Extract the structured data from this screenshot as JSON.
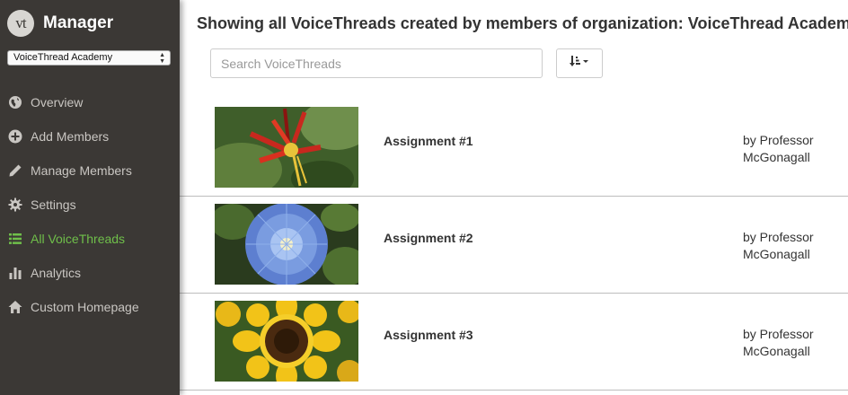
{
  "sidebar": {
    "logo_text": "vt",
    "title": "Manager",
    "org_select": "VoiceThread Academy",
    "items": [
      {
        "label": "Overview",
        "icon": "globe-icon",
        "active": false
      },
      {
        "label": "Add Members",
        "icon": "plus-circle-icon",
        "active": false
      },
      {
        "label": "Manage Members",
        "icon": "pencil-icon",
        "active": false
      },
      {
        "label": "Settings",
        "icon": "gear-icon",
        "active": false
      },
      {
        "label": "All VoiceThreads",
        "icon": "list-icon",
        "active": true
      },
      {
        "label": "Analytics",
        "icon": "bar-chart-icon",
        "active": false
      },
      {
        "label": "Custom Homepage",
        "icon": "home-icon",
        "active": false
      }
    ]
  },
  "main": {
    "heading": "Showing all VoiceThreads created by members of organization: VoiceThread Academy",
    "search_placeholder": "Search VoiceThreads",
    "sort_icon": "sort-icon",
    "threads": [
      {
        "title": "Assignment #1",
        "author_line1": "by Professor",
        "author_line2": "McGonagall",
        "thumbnail": "red-columbine-flower"
      },
      {
        "title": "Assignment #2",
        "author_line1": "by Professor",
        "author_line2": "McGonagall",
        "thumbnail": "blue-morning-glory-flower"
      },
      {
        "title": "Assignment #3",
        "author_line1": "by Professor",
        "author_line2": "McGonagall",
        "thumbnail": "sunflower"
      }
    ]
  },
  "colors": {
    "sidebar_bg": "#3b3835",
    "sidebar_text": "#c9c6c2",
    "active_text": "#6fbf4a"
  }
}
